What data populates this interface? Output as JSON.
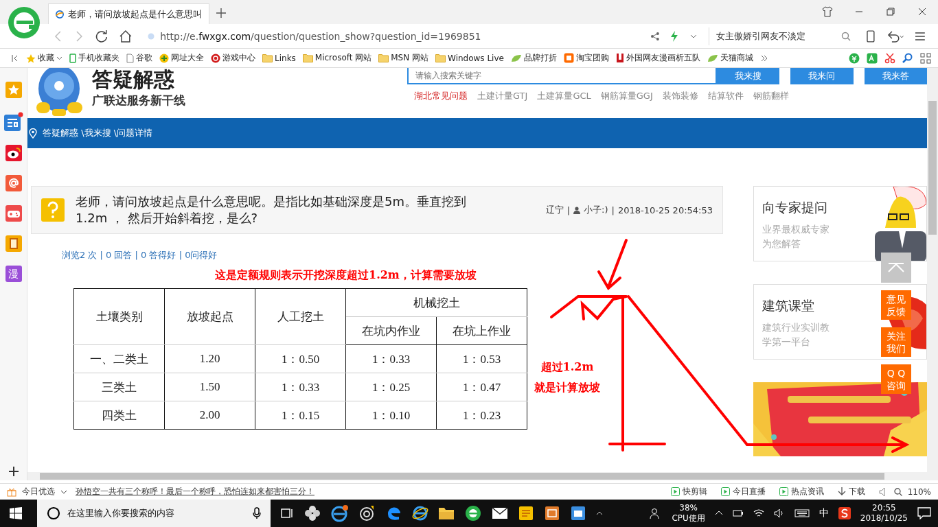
{
  "browser": {
    "tab_title": "老师，请问放坡起点是什么意思叫",
    "url_prefix": "http://e.",
    "url_domain": "fwxgx.com",
    "url_path": "/question/question_show?question_id=1969851",
    "search_hint": "女主傲娇引网友不淡定"
  },
  "bookmarks": [
    {
      "label": "收藏",
      "kind": "star"
    },
    {
      "label": "手机收藏夹",
      "kind": "phone"
    },
    {
      "label": "谷歌",
      "kind": "page"
    },
    {
      "label": "网址大全",
      "kind": "globe"
    },
    {
      "label": "游戏中心",
      "kind": "game"
    },
    {
      "label": "Links",
      "kind": "folder"
    },
    {
      "label": "Microsoft 网站",
      "kind": "folder"
    },
    {
      "label": "MSN 网站",
      "kind": "folder"
    },
    {
      "label": "Windows Live",
      "kind": "folder"
    },
    {
      "label": "品牌打折",
      "kind": "leaf"
    },
    {
      "label": "淘宝团购",
      "kind": "tao"
    },
    {
      "label": "外国网友漫画析五队",
      "kind": "book"
    },
    {
      "label": "天猫商城",
      "kind": "leaf"
    }
  ],
  "sidebar": {
    "manga_label": "漫"
  },
  "header": {
    "logo_title": "答疑解惑",
    "logo_subtitle": "广联达服务新干线",
    "search_placeholder": "请输入搜索关键字",
    "buttons": [
      "我来搜",
      "我来问",
      "我来答"
    ],
    "hot_links": [
      {
        "label": "湖北常见问题",
        "highlight": true
      },
      {
        "label": "土建计量GTJ",
        "highlight": false
      },
      {
        "label": "土建算量GCL",
        "highlight": false
      },
      {
        "label": "钢筋算量GGJ",
        "highlight": false
      },
      {
        "label": "装饰装修",
        "highlight": false
      },
      {
        "label": "结算软件",
        "highlight": false
      },
      {
        "label": "钢筋翻样",
        "highlight": false
      }
    ]
  },
  "breadcrumb": "答疑解惑 \\我来搜 \\问题详情",
  "question": {
    "separators": [
      "|",
      "|"
    ],
    "title": "老师，请问放坡起点是什么意思呢。是指比如基础深度是5m。垂直挖到1.2m ， 然后开始斜着挖，是么?",
    "region": "辽宁",
    "user": "小子:)",
    "time": "2018-10-25 20:54:53",
    "stats": "浏览2 次 | 0 回答 | 0 答得好 | 0问得好"
  },
  "annotation_top": "这是定额规则表示开挖深度超过1.2m，计算需要放坡",
  "annotation_side": [
    "超过1.2m",
    "就是计算放坡"
  ],
  "table": {
    "headers": [
      "土壤类别",
      "放坡起点",
      "人工挖土",
      "机械挖土"
    ],
    "subheaders": [
      "在坑内作业",
      "在坑上作业"
    ],
    "rows": [
      [
        "一、二类土",
        "1.20",
        "1：0.50",
        "1：0.33",
        "1：0.53"
      ],
      [
        "三类土",
        "1.50",
        "1：0.33",
        "1：0.25",
        "1：0.47"
      ],
      [
        "四类土",
        "2.00",
        "1：0.15",
        "1：0.10",
        "1：0.23"
      ]
    ]
  },
  "cards": [
    {
      "title": "向专家提问",
      "lines": [
        "业界最权威专家",
        "为您解答"
      ]
    },
    {
      "title": "建筑课堂",
      "lines": [
        "建筑行业实训教",
        "学第一平台"
      ]
    }
  ],
  "float_buttons": [
    [
      "意见",
      "反馈"
    ],
    [
      "关注",
      "我们"
    ],
    [
      "Q Q",
      "咨询"
    ]
  ],
  "status_bar": {
    "label": "今日优选",
    "news": "孙悟空一共有三个称呼！最后一个称呼，恐怕连如来都害怕三分！",
    "items": [
      "快剪辑",
      "今日直播",
      "热点资讯",
      "下载"
    ],
    "zoom": "110%"
  },
  "taskbar": {
    "search_placeholder": "在这里输入你要搜索的内容",
    "cpu_value": "38%",
    "cpu_label": "CPU使用",
    "ime": "中",
    "time": "20:55",
    "date": "2018/10/25"
  }
}
